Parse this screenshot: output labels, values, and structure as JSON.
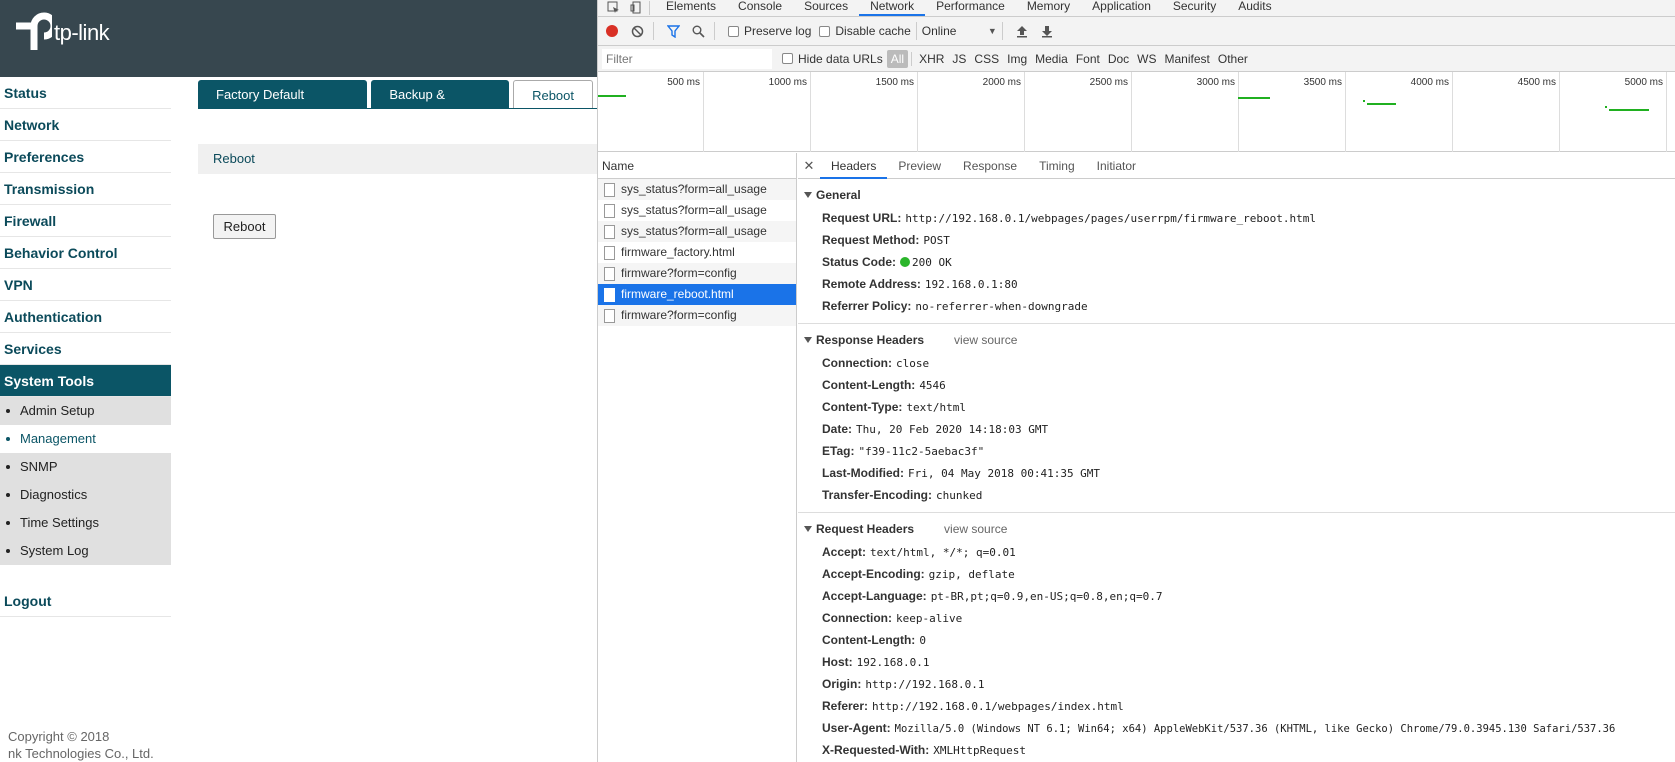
{
  "router": {
    "logo_text": "tp-link",
    "nav": [
      "Status",
      "Network",
      "Preferences",
      "Transmission",
      "Firewall",
      "Behavior Control",
      "VPN",
      "Authentication",
      "Services",
      "System Tools"
    ],
    "subnav": [
      "Admin Setup",
      "Management",
      "SNMP",
      "Diagnostics",
      "Time Settings",
      "System Log"
    ],
    "logout": "Logout",
    "copyright_1": "Copyright © 2018",
    "copyright_2": "nk Technologies Co., Ltd.",
    "tabs": [
      "Factory Default Restore",
      "Backup & Restore",
      "Reboot"
    ],
    "section_title": "Reboot",
    "reboot_button": "Reboot"
  },
  "devtools": {
    "tabs": [
      "Elements",
      "Console",
      "Sources",
      "Network",
      "Performance",
      "Memory",
      "Application",
      "Security",
      "Audits"
    ],
    "active_tab": "Network",
    "toolbar": {
      "preserve_log": "Preserve log",
      "disable_cache": "Disable cache",
      "throttle": "Online"
    },
    "filter_placeholder": "Filter",
    "hide_data_urls": "Hide data URLs",
    "filter_types": [
      "All",
      "XHR",
      "JS",
      "CSS",
      "Img",
      "Media",
      "Font",
      "Doc",
      "WS",
      "Manifest",
      "Other"
    ],
    "timeline_ticks": [
      "500 ms",
      "1000 ms",
      "1500 ms",
      "2000 ms",
      "2500 ms",
      "3000 ms",
      "3500 ms",
      "4000 ms",
      "4500 ms",
      "5000 ms"
    ],
    "name_header": "Name",
    "requests": [
      "sys_status?form=all_usage",
      "sys_status?form=all_usage",
      "sys_status?form=all_usage",
      "firmware_factory.html",
      "firmware?form=config",
      "firmware_reboot.html",
      "firmware?form=config"
    ],
    "selected_request": "firmware_reboot.html",
    "detail_tabs": [
      "Headers",
      "Preview",
      "Response",
      "Timing",
      "Initiator"
    ],
    "general": {
      "title": "General",
      "rows": [
        {
          "k": "Request URL:",
          "v": "http://192.168.0.1/webpages/pages/userrpm/firmware_reboot.html"
        },
        {
          "k": "Request Method:",
          "v": "POST"
        },
        {
          "k": "Status Code:",
          "v": "200 OK"
        },
        {
          "k": "Remote Address:",
          "v": "192.168.0.1:80"
        },
        {
          "k": "Referrer Policy:",
          "v": "no-referrer-when-downgrade"
        }
      ]
    },
    "response_headers": {
      "title": "Response Headers",
      "view_source": "view source",
      "rows": [
        {
          "k": "Connection:",
          "v": "close"
        },
        {
          "k": "Content-Length:",
          "v": "4546"
        },
        {
          "k": "Content-Type:",
          "v": "text/html"
        },
        {
          "k": "Date:",
          "v": "Thu, 20 Feb 2020 14:18:03 GMT"
        },
        {
          "k": "ETag:",
          "v": "\"f39-11c2-5aebac3f\""
        },
        {
          "k": "Last-Modified:",
          "v": "Fri, 04 May 2018 00:41:35 GMT"
        },
        {
          "k": "Transfer-Encoding:",
          "v": "chunked"
        }
      ]
    },
    "request_headers": {
      "title": "Request Headers",
      "view_source": "view source",
      "rows": [
        {
          "k": "Accept:",
          "v": "text/html, */*; q=0.01"
        },
        {
          "k": "Accept-Encoding:",
          "v": "gzip, deflate"
        },
        {
          "k": "Accept-Language:",
          "v": "pt-BR,pt;q=0.9,en-US;q=0.8,en;q=0.7"
        },
        {
          "k": "Connection:",
          "v": "keep-alive"
        },
        {
          "k": "Content-Length:",
          "v": "0"
        },
        {
          "k": "Host:",
          "v": "192.168.0.1"
        },
        {
          "k": "Origin:",
          "v": "http://192.168.0.1"
        },
        {
          "k": "Referer:",
          "v": "http://192.168.0.1/webpages/index.html"
        },
        {
          "k": "User-Agent:",
          "v": "Mozilla/5.0 (Windows NT 6.1; Win64; x64) AppleWebKit/537.36 (KHTML, like Gecko) Chrome/79.0.3945.130 Safari/537.36"
        },
        {
          "k": "X-Requested-With:",
          "v": "XMLHttpRequest"
        }
      ]
    }
  },
  "colors": {
    "router_header": "#37474f",
    "router_accent": "#0b5566",
    "devtools_accent": "#1a73e8",
    "timeline_bar": "#20b020"
  }
}
